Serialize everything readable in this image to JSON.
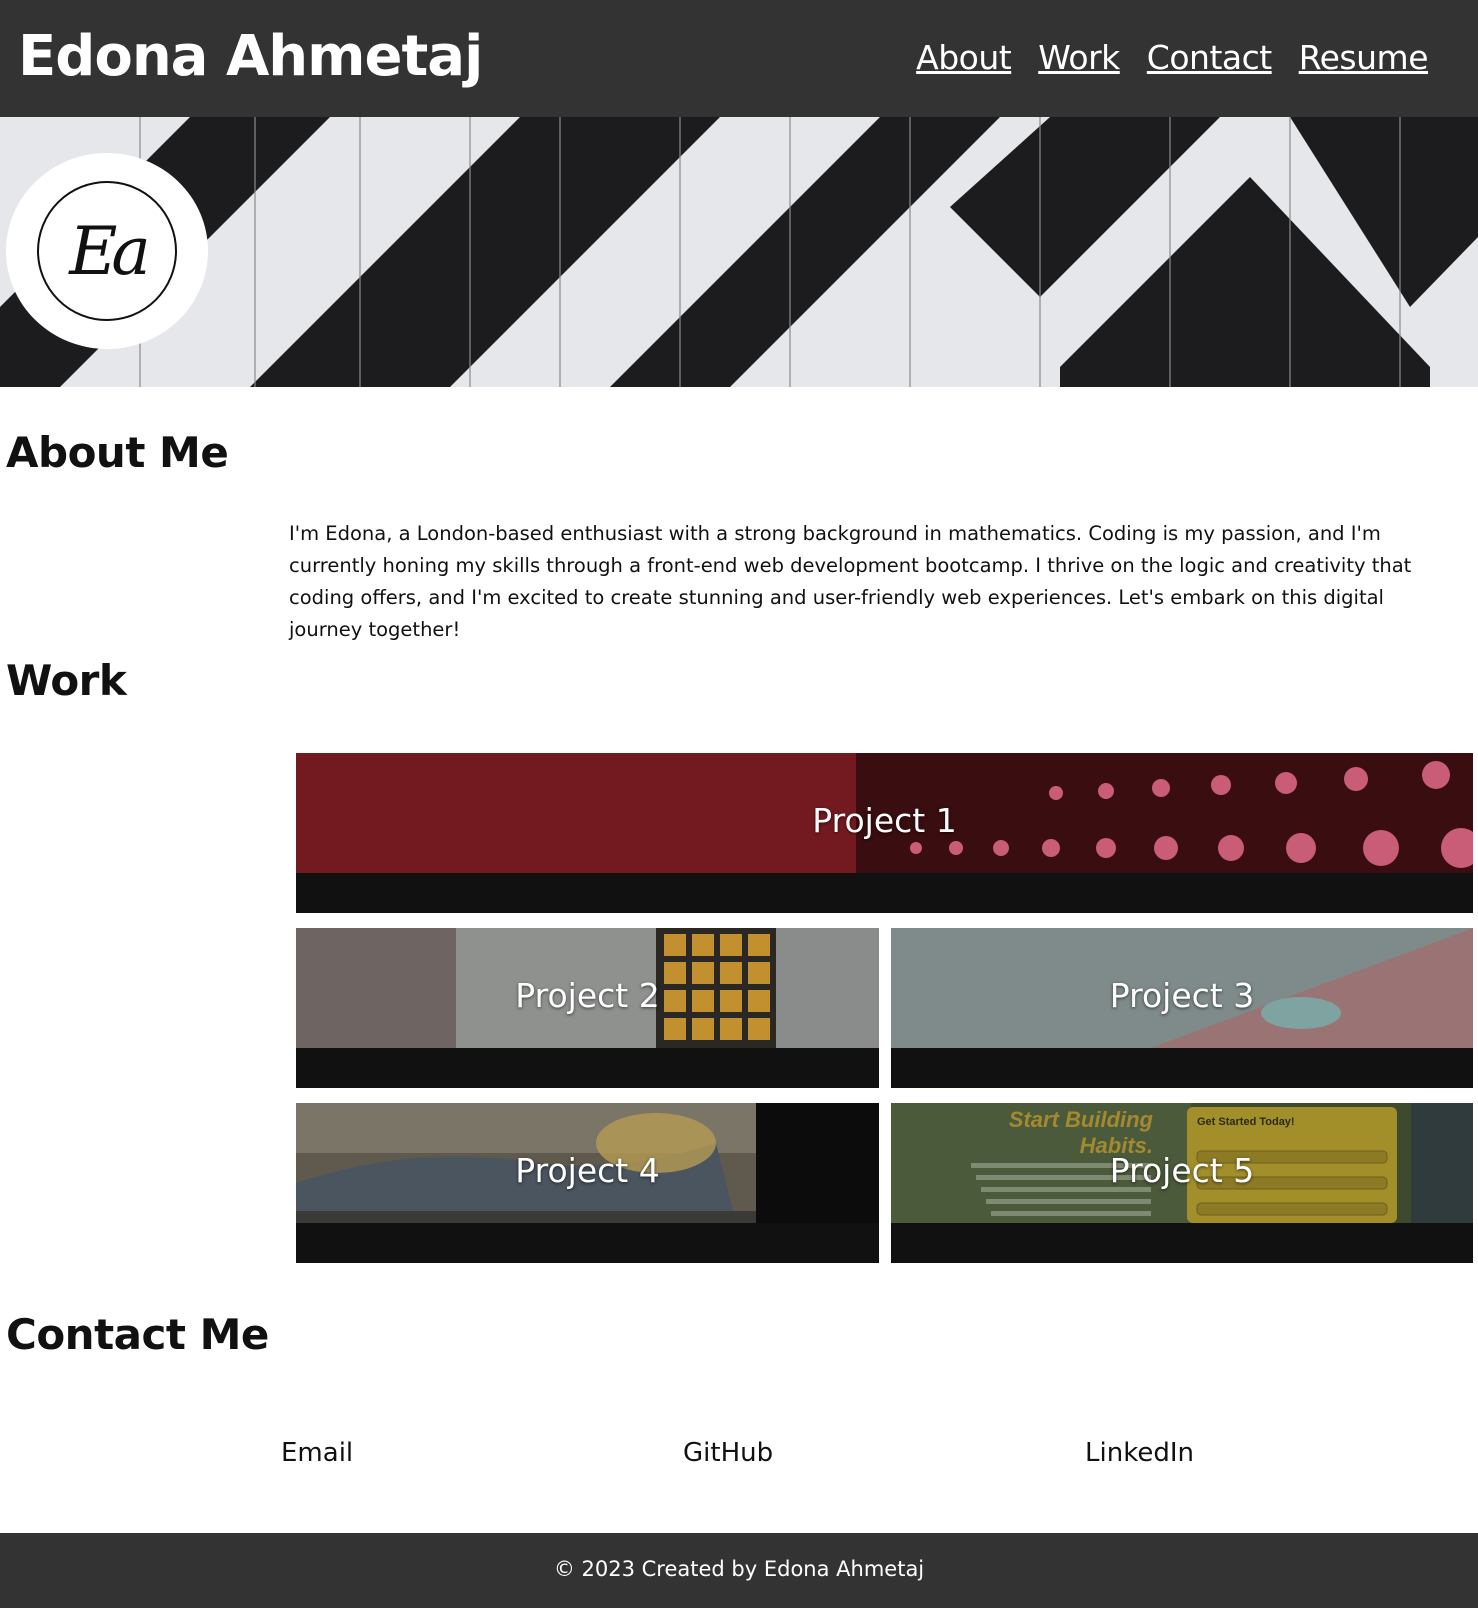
{
  "header": {
    "title": "Edona Ahmetaj",
    "nav": [
      "About",
      "Work",
      "Contact",
      "Resume"
    ]
  },
  "hero": {
    "logo_text": "Ea"
  },
  "about": {
    "heading": "About Me",
    "text": "I'm Edona, a London-based enthusiast with a strong background in mathematics. Coding is my passion, and I'm currently honing my skills through a front-end web development bootcamp. I thrive on the logic and creativity that coding offers, and I'm excited to create stunning and user-friendly web experiences. Let's embark on this digital journey together!"
  },
  "work": {
    "heading": "Work",
    "projects": [
      "Project 1",
      "Project 2",
      "Project 3",
      "Project 4",
      "Project 5"
    ]
  },
  "contact": {
    "heading": "Contact Me",
    "links": [
      "Email",
      "GitHub",
      "LinkedIn"
    ]
  },
  "footer": {
    "text": "© 2023 Created by Edona Ahmetaj"
  },
  "colors": {
    "header_bg": "#333333",
    "card_bg": "#111111",
    "text": "#111111"
  }
}
